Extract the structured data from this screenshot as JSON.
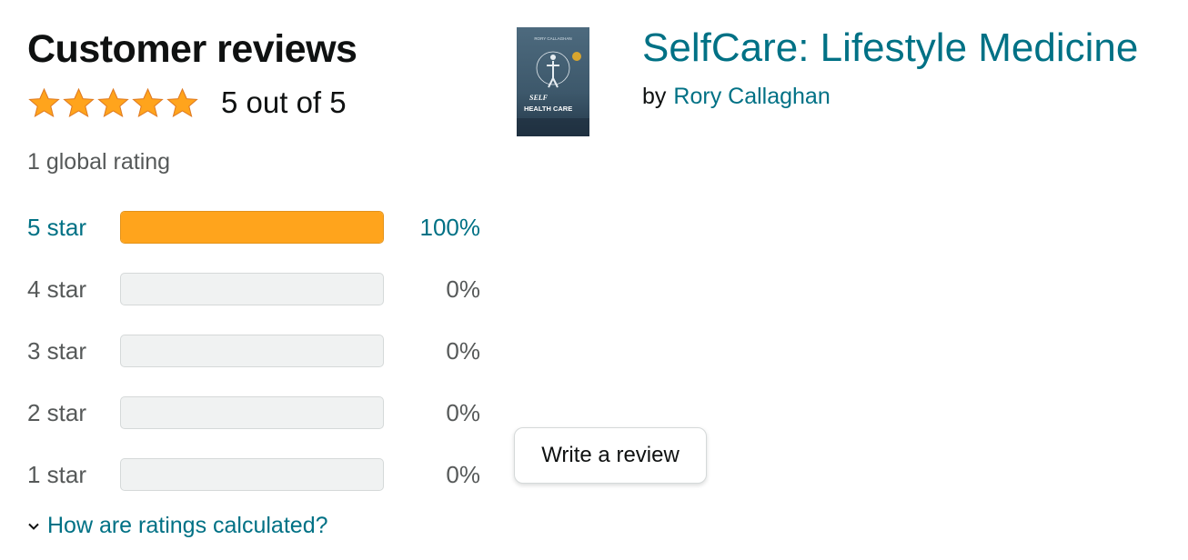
{
  "reviews": {
    "title": "Customer reviews",
    "stars_filled": 5,
    "average_text": "5 out of 5",
    "global_rating": "1 global rating",
    "histogram": [
      {
        "label": "5 star",
        "percent_text": "100%",
        "fraction": 1.0,
        "active": true
      },
      {
        "label": "4 star",
        "percent_text": "0%",
        "fraction": 0.0,
        "active": false
      },
      {
        "label": "3 star",
        "percent_text": "0%",
        "fraction": 0.0,
        "active": false
      },
      {
        "label": "2 star",
        "percent_text": "0%",
        "fraction": 0.0,
        "active": false
      },
      {
        "label": "1 star",
        "percent_text": "0%",
        "fraction": 0.0,
        "active": false
      }
    ],
    "how_calculated": "How are ratings calculated?"
  },
  "product": {
    "title": "SelfCare: Lifestyle Medicine",
    "by_label": "by",
    "author": "Rory Callaghan",
    "cover": {
      "author_text": "RORY CALLAGHAN",
      "title_line1": "SELF",
      "title_line2": "HEALTH CARE"
    },
    "write_review": "Write a review"
  },
  "colors": {
    "link": "#007185",
    "star": "#ffa41c",
    "bar_empty": "#f0f2f2",
    "text_secondary": "#565959"
  },
  "icons": {
    "star": "star-icon",
    "chevron": "chevron-down-icon"
  }
}
